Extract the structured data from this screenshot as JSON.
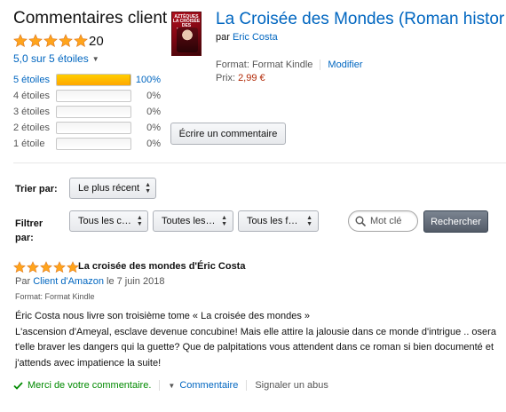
{
  "header": {
    "title": "Commentaires client",
    "rating_count": "20",
    "average_label": "5,0 sur 5 étoiles",
    "star_color": "#ffa41c"
  },
  "histogram": [
    {
      "label": "5 étoiles",
      "percent_label": "100%",
      "fraction": 1.0,
      "active": true
    },
    {
      "label": "4 étoiles",
      "percent_label": "0%",
      "fraction": 0,
      "active": false
    },
    {
      "label": "3 étoiles",
      "percent_label": "0%",
      "fraction": 0,
      "active": false
    },
    {
      "label": "2 étoiles",
      "percent_label": "0%",
      "fraction": 0,
      "active": false
    },
    {
      "label": "1 étoile",
      "percent_label": "0%",
      "fraction": 0,
      "active": false
    }
  ],
  "product": {
    "title": "La Croisée des Mondes (Roman histor…",
    "by_prefix": "par",
    "author": "Eric Costa",
    "format_text": "Format: Format Kindle",
    "modify_label": "Modifier",
    "price_prefix": "Prix:",
    "price": "2,99 €",
    "cover_text": "AZTÈQUES LA CROISÉE DES MONDES"
  },
  "write_review_label": "Écrire un commentaire",
  "sort": {
    "label": "Trier par:",
    "selected": "Le plus récent"
  },
  "filter": {
    "label": "Filtrer par:",
    "selects": [
      "Tous les c…",
      "Toutes les…",
      "Tous les f…"
    ]
  },
  "search": {
    "placeholder": "Mot clé",
    "button_label": "Rechercher"
  },
  "review": {
    "stars": 5,
    "title": "La croisée des mondes d'Éric Costa",
    "by_prefix": "Par",
    "reviewer": "Client d'Amazon",
    "date": "le 7 juin 2018",
    "format": "Format: Format Kindle",
    "body_lines": [
      "Éric Costa nous livre son troisième tome « La croisée des mondes »",
      "L'ascension d'Ameyal, esclave devenue concubine! Mais elle attire la jalousie dans ce monde d'intrigue .. osera",
      "t'elle braver les dangers qui la guette? Que de palpitations vous attendent dans ce roman si bien documenté et",
      "j'attends avec impatience la suite!"
    ],
    "thanks_label": "Merci de votre commentaire.",
    "comment_label": "Commentaire",
    "report_label": "Signaler un abus"
  }
}
